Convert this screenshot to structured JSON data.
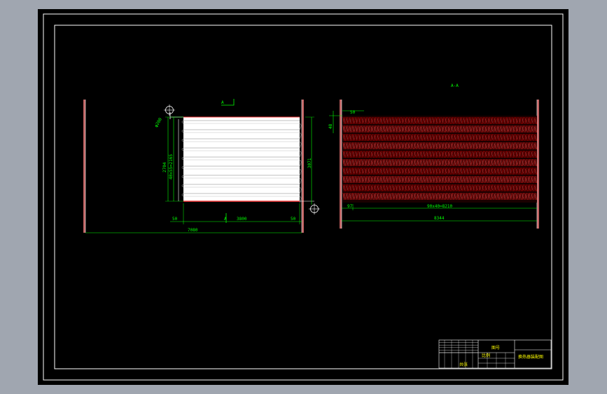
{
  "drawing": {
    "view_a_marker": "A",
    "view_a_section_title": "A-A",
    "dim_left_pipe_dia": "φ200",
    "dim_left_height": "2704",
    "dim_left_pitch": "40x55=2165",
    "dim_left_end_left": "50",
    "dim_left_center": "3800",
    "dim_left_end_right": "50",
    "dim_left_overall": "7080",
    "dim_left_right_height": "3071",
    "dim_right_top": "50",
    "dim_right_left_height": "48",
    "dim_right_start": "97",
    "dim_right_pitch": "90x40=8210",
    "dim_right_overall": "8344"
  },
  "title_block": {
    "name_label": "图号",
    "drawing_name": "换热器装配图",
    "scale_label": "比例",
    "sheet_label": "共张"
  },
  "colors": {
    "background": "#000000",
    "frame": "#ffffff",
    "dimension": "#00ff00",
    "tube_red": "#ff0000",
    "wall": "#ff8080",
    "text_yellow": "#ffff00"
  }
}
